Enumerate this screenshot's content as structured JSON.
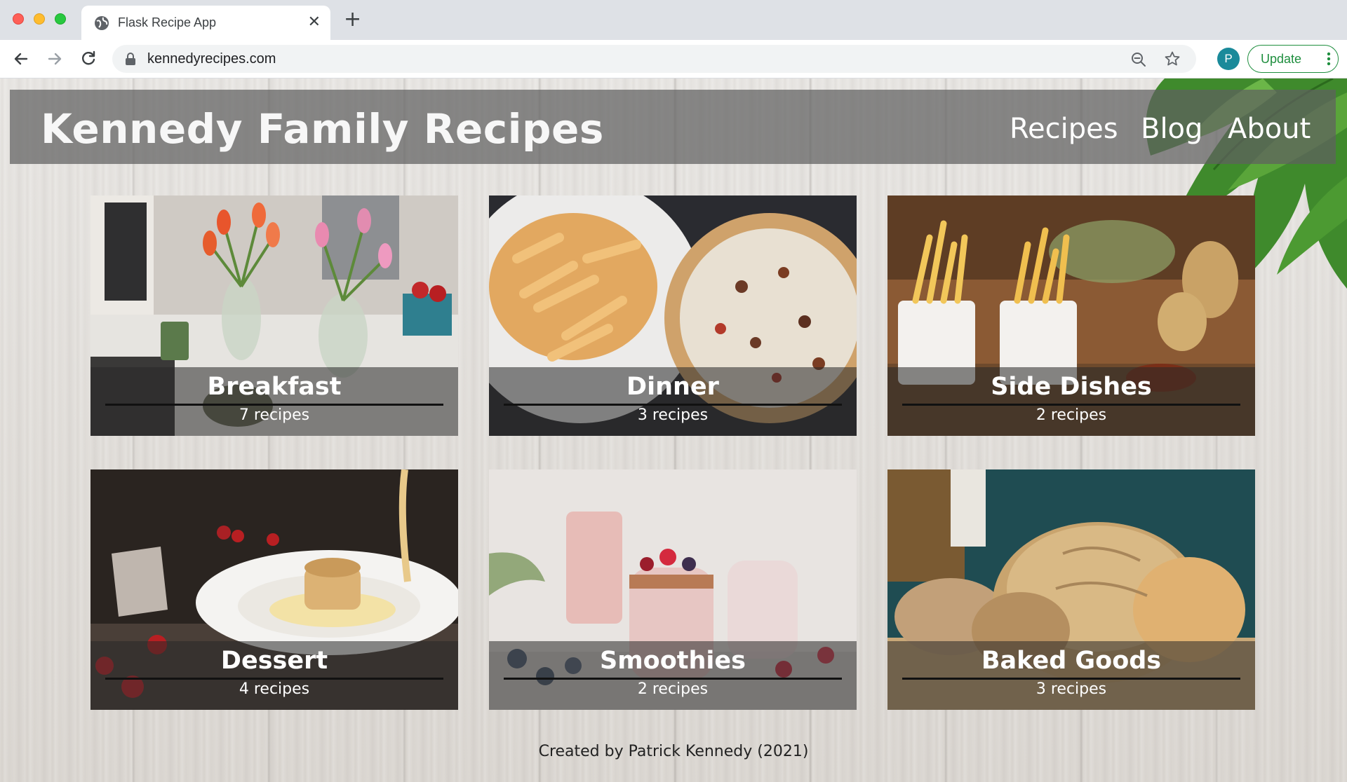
{
  "browser": {
    "tab_title": "Flask Recipe App",
    "url": "kennedyrecipes.com",
    "profile_initial": "P",
    "update_label": "Update"
  },
  "header": {
    "title": "Kennedy Family Recipes",
    "nav": [
      "Recipes",
      "Blog",
      "About"
    ]
  },
  "categories": [
    {
      "name": "Breakfast",
      "count": "7 recipes"
    },
    {
      "name": "Dinner",
      "count": "3 recipes"
    },
    {
      "name": "Side Dishes",
      "count": "2 recipes"
    },
    {
      "name": "Dessert",
      "count": "4 recipes"
    },
    {
      "name": "Smoothies",
      "count": "2 recipes"
    },
    {
      "name": "Baked Goods",
      "count": "3 recipes"
    }
  ],
  "footer": {
    "text": "Created by Patrick Kennedy (2021)"
  },
  "colors": {
    "update_green": "#1e8e3e",
    "header_overlay": "#5f5f5f",
    "avatar": "#1a8a9a"
  }
}
